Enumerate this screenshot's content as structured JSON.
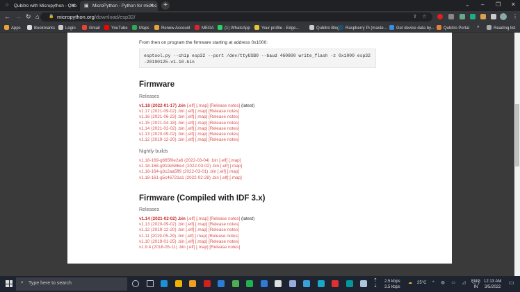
{
  "browser": {
    "tabs": [
      {
        "title": "Qubitro with Micropython - Qub",
        "active": false
      },
      {
        "title": "MicroPython - Python for microc",
        "active": true
      }
    ],
    "url_host": "micropython.org",
    "url_path": "/download/esp32/",
    "bookmarks": [
      "Apps",
      "Bookmarks",
      "Login",
      "Gmail",
      "YouTube",
      "Maps",
      "Renew Account",
      "MEGA",
      "(1) WhatsApp",
      "Your profile - Edge...",
      "Qubitro Blog",
      "Raspberry Pi (maste...",
      "Get device data by...",
      "Qubitro Portal"
    ],
    "reading_list": "Reading list",
    "bookmark_colors": [
      "#e8a33d",
      "#ddd",
      "#ccc",
      "#ea4335",
      "#ff0000",
      "#34a853",
      "#e8a33d",
      "#d9272e",
      "#25d366",
      "#e8c23d",
      "#ccc",
      "#1f4f6f",
      "#3b8de0",
      "#e87f3d"
    ]
  },
  "page": {
    "intro": "From then on program the firmware starting at address 0x1000:",
    "code": "esptool.py --chip esp32 --port /dev/ttyUSB0 --baud 460800 write_flash -z 0x1000 esp32-20190125-v1.10.bin",
    "sections": [
      {
        "title": "Firmware",
        "groups": [
          {
            "label": "Releases",
            "rows": [
              {
                "name": "v1.18 (2022-01-17) .bin",
                "links": "[.elf] [.map] [Release notes]",
                "latest": "(latest)"
              },
              {
                "name": "v1.17 (2021-09-02) .bin",
                "links": "[.elf] [.map] [Release notes]"
              },
              {
                "name": "v1.16 (2021-06-23) .bin",
                "links": "[.elf] [.map] [Release notes]"
              },
              {
                "name": "v1.15 (2021-04-18) .bin",
                "links": "[.elf] [.map] [Release notes]"
              },
              {
                "name": "v1.14 (2021-02-02) .bin",
                "links": "[.elf] [.map] [Release notes]"
              },
              {
                "name": "v1.13 (2020-09-02) .bin",
                "links": "[.elf] [.map] [Release notes]"
              },
              {
                "name": "v1.12 (2019-12-20) .bin",
                "links": "[.elf] [.map] [Release notes]"
              }
            ]
          },
          {
            "label": "Nightly builds",
            "rows": [
              {
                "name": "v1.18-169-g665f0e2a6 (2022-03-04) .bin",
                "links": "[.elf] [.map]"
              },
              {
                "name": "v1.18-168-g919e586e4 (2022-03-02) .bin",
                "links": "[.elf] [.map]"
              },
              {
                "name": "v1.18-164-g3c2aa5ff9 (2022-03-01) .bin",
                "links": "[.elf] [.map]"
              },
              {
                "name": "v1.18-161-g5c46721a1 (2022-02-28) .bin",
                "links": "[.elf] [.map]"
              }
            ]
          }
        ]
      },
      {
        "title": "Firmware (Compiled with IDF 3.x)",
        "groups": [
          {
            "label": "Releases",
            "rows": [
              {
                "name": "v1.14 (2021-02-02) .bin",
                "links": "[.elf] [.map] [Release notes]",
                "latest": "(latest)"
              },
              {
                "name": "v1.13 (2020-09-02) .bin",
                "links": "[.elf] [.map] [Release notes]"
              },
              {
                "name": "v1.12 (2019-12-20) .bin",
                "links": "[.elf] [.map] [Release notes]"
              },
              {
                "name": "v1.11 (2019-05-29) .bin",
                "links": "[.elf] [.map] [Release notes]"
              },
              {
                "name": "v1.10 (2019-01-25) .bin",
                "links": "[.elf] [.map] [Release notes]"
              },
              {
                "name": "v1.9.4 (2018-05-11) .bin",
                "links": "[.elf] [.map] [Release notes]"
              }
            ]
          }
        ]
      }
    ]
  },
  "taskbar": {
    "search_placeholder": "Type here to search",
    "net_up": "2.5 kbps",
    "net_down": "3.5 kbps",
    "weather": "25°C",
    "lang": "ENG",
    "region": "IN",
    "time": "12:13 AM",
    "date": "3/5/2022",
    "app_colors": [
      "#ccc",
      "#ccc",
      "#1e90d6",
      "#f0b400",
      "#f0a020",
      "#d02020",
      "#2a7fd4",
      "#4caf50",
      "#22b14c",
      "#2f7bd8",
      "#e0e0e0",
      "#9ad",
      "#3aa0d8",
      "#1ba7c8",
      "#e03030",
      "#00979d",
      "#b0c4de"
    ]
  }
}
